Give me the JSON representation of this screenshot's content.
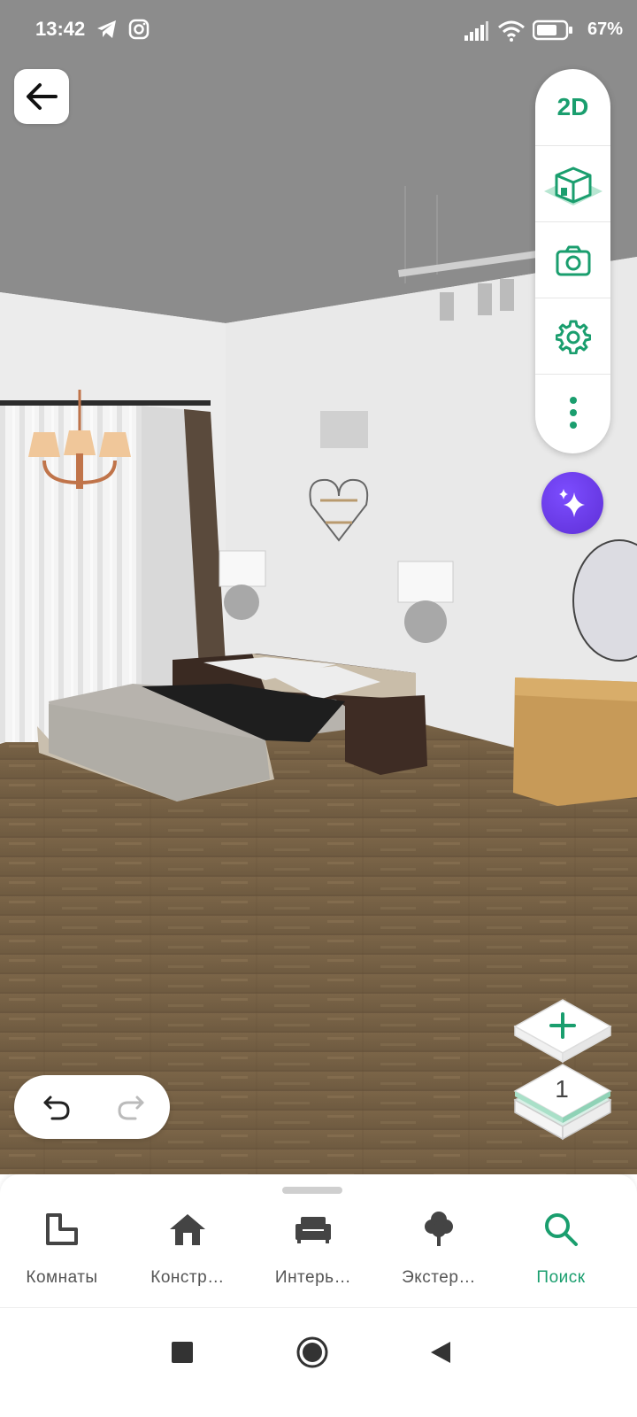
{
  "status_bar": {
    "time": "13:42",
    "battery": "67%"
  },
  "toolbar": {
    "view_2d_label": "2D"
  },
  "floors": {
    "current": "1"
  },
  "bottom_nav": {
    "items": [
      {
        "label": "Комнаты",
        "icon": "room-icon"
      },
      {
        "label": "Констр…",
        "icon": "house-icon"
      },
      {
        "label": "Интерь…",
        "icon": "sofa-icon"
      },
      {
        "label": "Экстер…",
        "icon": "tree-icon"
      },
      {
        "label": "Поиск",
        "icon": "search-icon",
        "active": true
      }
    ]
  },
  "colors": {
    "accent": "#1a9e6e",
    "ai_button": "#6a3ae6"
  }
}
